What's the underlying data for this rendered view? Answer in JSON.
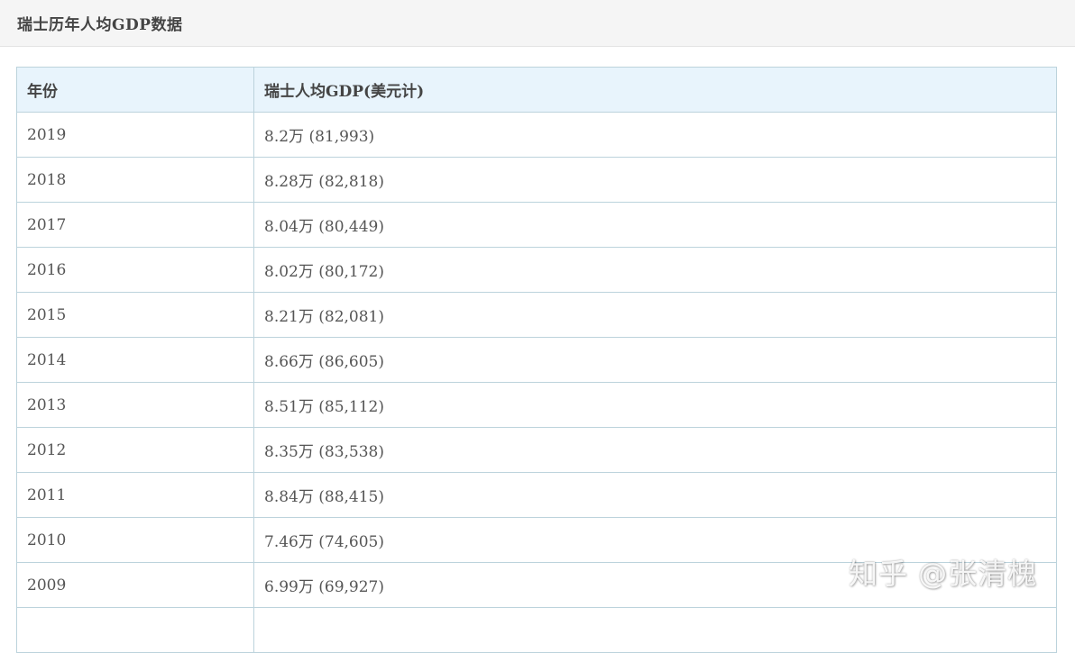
{
  "header": {
    "title": "瑞士历年人均GDP数据"
  },
  "table": {
    "columns": [
      "年份",
      "瑞士人均GDP(美元计)"
    ],
    "rows": [
      {
        "year": "2019",
        "gdp": "8.2万 (81,993)"
      },
      {
        "year": "2018",
        "gdp": "8.28万 (82,818)"
      },
      {
        "year": "2017",
        "gdp": "8.04万 (80,449)"
      },
      {
        "year": "2016",
        "gdp": "8.02万 (80,172)"
      },
      {
        "year": "2015",
        "gdp": "8.21万 (82,081)"
      },
      {
        "year": "2014",
        "gdp": "8.66万 (86,605)"
      },
      {
        "year": "2013",
        "gdp": "8.51万 (85,112)"
      },
      {
        "year": "2012",
        "gdp": "8.35万 (83,538)"
      },
      {
        "year": "2011",
        "gdp": "8.84万 (88,415)"
      },
      {
        "year": "2010",
        "gdp": "7.46万 (74,605)"
      },
      {
        "year": "2009",
        "gdp": "6.99万 (69,927)"
      },
      {
        "year": "",
        "gdp": ""
      }
    ]
  },
  "watermark": {
    "text": "知乎 @张清槐"
  },
  "colors": {
    "header_bg": "#f5f5f5",
    "table_header_bg": "#e8f4fc",
    "border": "#bcd3dc",
    "text": "#555555"
  }
}
